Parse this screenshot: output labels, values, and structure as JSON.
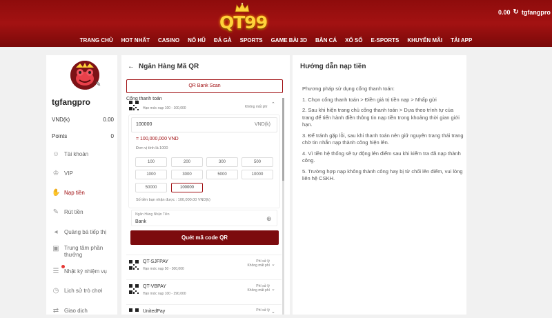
{
  "header": {
    "logo_text": "QT99",
    "balance": "0.00",
    "username": "tgfangpro",
    "nav": [
      "TRANG CHỦ",
      "HOT NHẤT",
      "CASINO",
      "NỔ HŨ",
      "ĐÁ GÀ",
      "SPORTS",
      "GAME BÀI 3D",
      "BẮN CÁ",
      "XỔ SỐ",
      "E-SPORTS",
      "KHUYẾN MÃI",
      "TẢI APP"
    ]
  },
  "sidebar": {
    "username": "tgfangpro",
    "vnd_label": "VND(k)",
    "vnd_value": "0.00",
    "points_label": "Points",
    "points_value": "0",
    "items": [
      {
        "label": "Tài khoản",
        "icon": "user-icon"
      },
      {
        "label": "VIP",
        "icon": "vip-icon"
      },
      {
        "label": "Nạp tiền",
        "icon": "deposit-icon"
      },
      {
        "label": "Rút tiền",
        "icon": "withdraw-icon"
      },
      {
        "label": "Quảng bá tiếp thị",
        "icon": "megaphone-icon"
      },
      {
        "label": "Trung tâm phần thưởng",
        "icon": "gift-icon"
      },
      {
        "label": "Nhật ký nhiệm vụ",
        "icon": "task-icon"
      },
      {
        "label": "Lịch sử trò chơi",
        "icon": "history-icon"
      },
      {
        "label": "Giao dịch",
        "icon": "transaction-icon"
      }
    ]
  },
  "main": {
    "title": "Ngân Hàng Mã QR",
    "qr_scan_button": "QR Bank Scan",
    "gateway_title": "Cổng thanh toán",
    "first_gateway": {
      "limit": "Hạn mức nạp 100 - 100,000",
      "fee": "Không mất phí"
    },
    "amount_value": "100000",
    "amount_unit": "VND(k)",
    "converted": "= 100,000,000 VND",
    "unit_note": "Đơn vị tính là 1000",
    "chips": [
      "100",
      "200",
      "300",
      "500",
      "1000",
      "3000",
      "5000",
      "10000",
      "50000",
      "100000"
    ],
    "selected_chip": "100000",
    "received_note": "Số tiền bạn nhận được : 100,000.00 VND(k)",
    "bank_label": "Ngân Hàng Nhận Tiền",
    "bank_value": "Bank",
    "scan_button": "Quét mã code QR",
    "gateways": [
      {
        "name": "QT-SJFPAY",
        "limit": "Hạn mức nạp 50 - 300,000",
        "fee_line1": "Phí sử lý",
        "fee_line2": "Không mất phí"
      },
      {
        "name": "QT-VBPAY",
        "limit": "Hạn mức nạp 100 - 290,000",
        "fee_line1": "Phí sử lý",
        "fee_line2": "Không mất phí"
      },
      {
        "name": "UnitedPay",
        "limit": "",
        "fee_line1": "Phí sử lý",
        "fee_line2": ""
      }
    ]
  },
  "guide": {
    "title": "Hướng dẫn nạp tiền",
    "paragraphs": [
      "Phương pháp sử dụng cổng thanh toán:",
      "1. Chọn cổng thanh toán > Điền giá trị tiền nạp > Nhấp gửi",
      "2. Sau khi hiện trang chủ cổng thanh toán > Dựa theo trình tự của trang để tiến hành điền thông tin nạp tiền trong khoảng thời gian giới hạn.",
      "3. Để tránh gặp lỗi, sau khi thanh toán nên giữ nguyên trang thái trang chờ tin nhắn nạp thành công hiện lên.",
      "4. Vì tiền hệ thống sẽ tự động lên điểm sau khi kiểm tra đã nạp thành công.",
      "5. Trường hợp nạp không thành công hay bị từ chối lên điểm, vui lòng liên hệ CSKH."
    ]
  },
  "colors": {
    "brand": "#a00f12",
    "header_red": "#8e0c0c",
    "button_dark_red": "#7c0b0e",
    "logo_gold": "#ffd23a"
  }
}
